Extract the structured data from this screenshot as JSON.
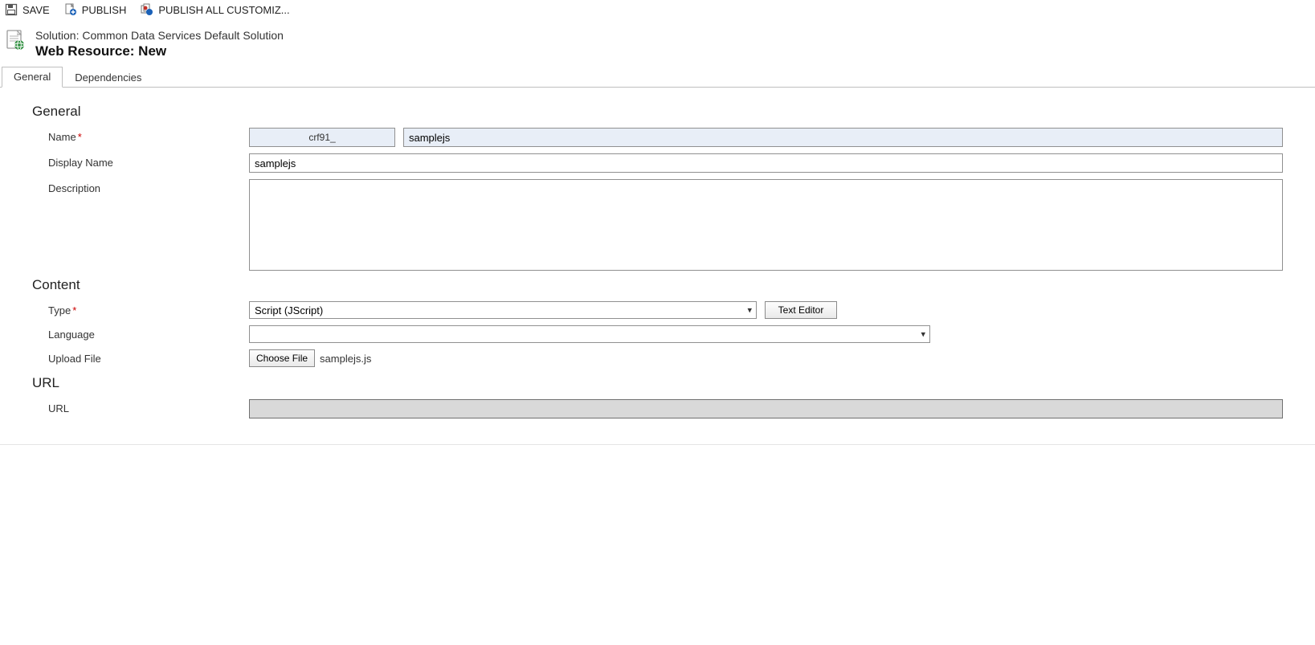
{
  "toolbar": {
    "save_label": "SAVE",
    "publish_label": "PUBLISH",
    "publish_all_label": "PUBLISH ALL CUSTOMIZ..."
  },
  "header": {
    "solution_line": "Solution: Common Data Services Default Solution",
    "entity_line": "Web Resource: New"
  },
  "tabs": {
    "general": "General",
    "dependencies": "Dependencies"
  },
  "sections": {
    "general": "General",
    "content": "Content",
    "url": "URL"
  },
  "labels": {
    "name": "Name",
    "display_name": "Display Name",
    "description": "Description",
    "type": "Type",
    "language": "Language",
    "upload_file": "Upload File",
    "url": "URL"
  },
  "fields": {
    "name_prefix": "crf91_",
    "name_value": "samplejs",
    "display_name_value": "samplejs",
    "description_value": "",
    "type_value": "Script (JScript)",
    "language_value": "",
    "upload_filename": "samplejs.js",
    "url_value": ""
  },
  "buttons": {
    "text_editor": "Text Editor",
    "choose_file": "Choose File"
  }
}
